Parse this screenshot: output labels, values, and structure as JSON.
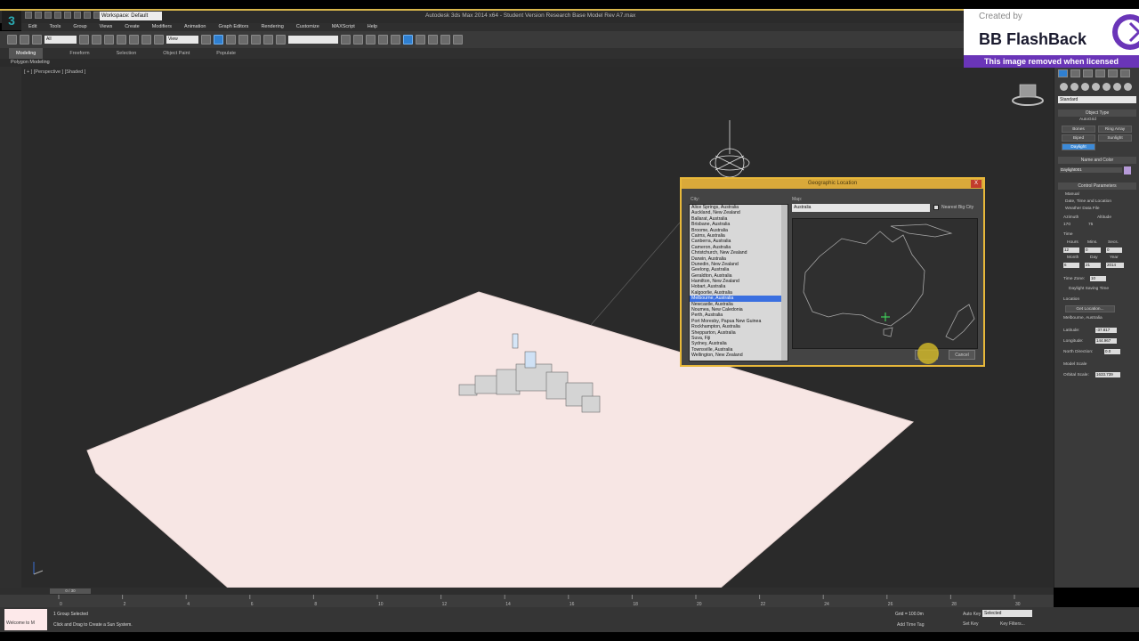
{
  "app": {
    "title": "Autodesk 3ds Max 2014 x64 - Student Version  Research Base Model Rev A7.max",
    "workspace": "Workspace: Default",
    "logo_glyph": "3"
  },
  "menu": [
    "Edit",
    "Tools",
    "Group",
    "Views",
    "Create",
    "Modifiers",
    "Animation",
    "Graph Editors",
    "Rendering",
    "Customize",
    "MAXScript",
    "Help"
  ],
  "toolbar": {
    "selection_filter": "All",
    "ref_coord": "View"
  },
  "ribbon": {
    "tabs": [
      "Modeling",
      "Freeform",
      "Selection",
      "Object Paint",
      "Populate"
    ],
    "sub_label": "Polygon Modeling"
  },
  "viewport": {
    "label": "[ + ] [Perspective ] [Shaded ]",
    "terrain_color": "#f7e6e4",
    "background": "#2a2a2a"
  },
  "geo_dialog": {
    "title": "Geographic Location",
    "close": "X",
    "city_label": "City:",
    "map_label": "Map:",
    "map_value": "Australia",
    "nearest_label": "Nearest Big City",
    "cancel": "Cancel",
    "selected_index": 16,
    "cities": [
      "Alice Springs, Australia",
      "Auckland, New Zealand",
      "Ballarat, Australia",
      "Brisbane, Australia",
      "Broome, Australia",
      "Cairns, Australia",
      "Canberra, Australia",
      "Cameron, Australia",
      "Christchurch, New Zealand",
      "Darwin, Australia",
      "Dunedin, New Zealand",
      "Geelong, Australia",
      "Geraldton, Australia",
      "Hamilton, New Zealand",
      "Hobart, Australia",
      "Kalgoorlie, Australia",
      "Melbourne, Australia",
      "Newcastle, Australia",
      "Noumea, New Caledonia",
      "Perth, Australia",
      "Port Moresby, Papua New Guinea",
      "Rockhampton, Australia",
      "Shepparton, Australia",
      "Suva, Fiji",
      "Sydney, Australia",
      "Townsville, Australia",
      "Wellington, New Zealand"
    ]
  },
  "command_panel": {
    "dropdown": "Standard",
    "object_type_label": "Object Type",
    "autogrid": "AutoGrid",
    "buttons": [
      "Bones",
      "Ring Array",
      "Biped",
      "Sunlight",
      "Daylight"
    ],
    "name_color_label": "Name and Color",
    "object_name": "Daylight001",
    "control_params_label": "Control Parameters",
    "manual": "Manual",
    "date_time_location": "Date, Time and Location",
    "weather_file": "Weather Data File",
    "azimuth_label": "Azimuth",
    "altitude_label": "Altitude",
    "azimuth": "170",
    "altitude": "75",
    "time_label": "Time",
    "hours_label": "Hours",
    "mins_label": "Mins.",
    "secs_label": "Secs.",
    "hours": "12",
    "mins": "0",
    "secs": "0",
    "month_label": "Month",
    "day_label": "Day",
    "year_label": "Year",
    "month": "6",
    "day": "21",
    "year": "2014",
    "time_zone_label": "Time Zone:",
    "time_zone": "10",
    "dst": "Daylight Saving Time",
    "location_label": "Location",
    "get_location": "Get Location...",
    "location": "Melbourne, Australia",
    "latitude_label": "Latitude:",
    "latitude": "-37.817",
    "longitude_label": "Longitude:",
    "longitude": "144.967",
    "north_label": "North Direction:",
    "north": "0.0",
    "model_scale_label": "Model Scale",
    "orbital_label": "Orbital Scale:",
    "orbital": "1633.739"
  },
  "watermark": {
    "created_by": "Created by",
    "brand": "BB FlashBack",
    "removed": "This image removed when licensed"
  },
  "timeline": {
    "slider": "0 / 30",
    "ticks": [
      "0",
      "2",
      "4",
      "6",
      "8",
      "10",
      "12",
      "14",
      "16",
      "18",
      "20",
      "22",
      "24",
      "26",
      "28",
      "30"
    ]
  },
  "status": {
    "maxscript": "Welcome to M",
    "selected": "1 Group Selected",
    "prompt": "Click and Drag to Create a Sun System.",
    "grid": "Grid = 100.0m",
    "auto_key": "Auto Key",
    "selected_dropdown": "Selected",
    "set_key": "Set Key",
    "key_filters": "Key Filters...",
    "add_time_tag": "Add Time Tag"
  }
}
